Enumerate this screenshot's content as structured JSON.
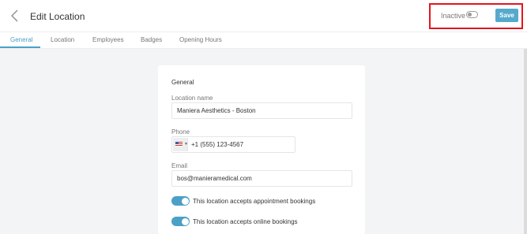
{
  "header": {
    "title": "Edit Location",
    "status_label": "Inactive",
    "save_label": "Save",
    "active_toggle_on": false
  },
  "tabs": [
    {
      "label": "General",
      "active": true
    },
    {
      "label": "Location",
      "active": false
    },
    {
      "label": "Employees",
      "active": false
    },
    {
      "label": "Badges",
      "active": false
    },
    {
      "label": "Opening Hours",
      "active": false
    }
  ],
  "form": {
    "section_title": "General",
    "location_name": {
      "label": "Location name",
      "value": "Maniera Aesthetics - Boston"
    },
    "phone": {
      "label": "Phone",
      "value": "+1 (555) 123-4567",
      "country_flag": "us-flag-icon"
    },
    "email": {
      "label": "Email",
      "value": "bos@manieramedical.com"
    },
    "toggles": [
      {
        "label": "This location accepts appointment bookings",
        "on": true
      },
      {
        "label": "This location accepts online bookings",
        "on": true
      }
    ]
  },
  "colors": {
    "accent": "#4ba0c6",
    "save_button": "#55aacc",
    "highlight_border": "#e5141c",
    "background": "#f3f4f5"
  }
}
